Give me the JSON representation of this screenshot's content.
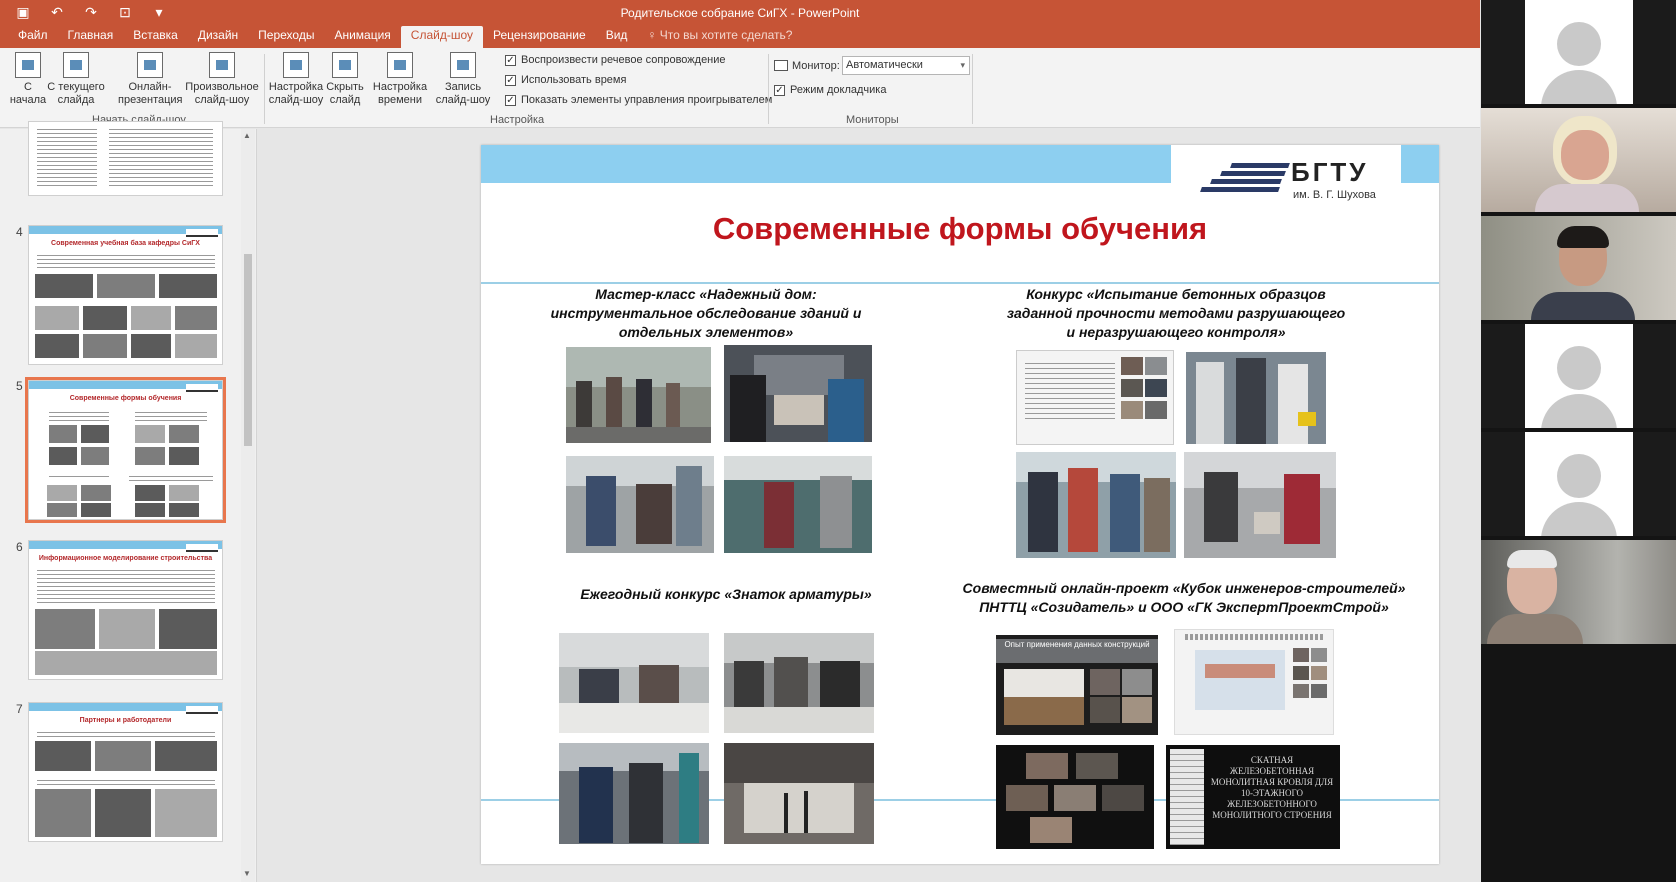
{
  "window": {
    "title": "Родительское собрание СиГХ - PowerPoint"
  },
  "tabs": [
    {
      "label": "Файл"
    },
    {
      "label": "Главная"
    },
    {
      "label": "Вставка"
    },
    {
      "label": "Дизайн"
    },
    {
      "label": "Переходы"
    },
    {
      "label": "Анимация"
    },
    {
      "label": "Слайд-шоу"
    },
    {
      "label": "Рецензирование"
    },
    {
      "label": "Вид"
    }
  ],
  "tell_me": "Что вы хотите сделать?",
  "ribbon": {
    "from_start": "С начала",
    "from_current": "С текущего слайда",
    "online": "Онлайн-презентация",
    "custom": "Произвольное слайд-шоу",
    "group_start": "Начать слайд-шоу",
    "setup": "Настройка слайд-шоу",
    "hide": "Скрыть слайд",
    "timing": "Настройка времени",
    "record": "Запись слайд-шоу",
    "chk_narration": "Воспроизвести речевое сопровождение",
    "chk_timings": "Использовать время",
    "chk_controls": "Показать элементы управления проигрывателем",
    "group_setup": "Настройка",
    "monitor_label": "Монитор:",
    "monitor_value": "Автоматически",
    "presenter_view": "Режим докладчика",
    "group_monitors": "Мониторы"
  },
  "thumbnails": [
    {
      "num": "4",
      "title": "Современная учебная база кафедры СиГХ"
    },
    {
      "num": "5",
      "title": "Современные формы обучения"
    },
    {
      "num": "6",
      "title": "Информационное моделирование строительства"
    },
    {
      "num": "7",
      "title": "Партнеры и работодатели"
    }
  ],
  "slide": {
    "logo_name": "БГТУ",
    "logo_sub": "им. В. Г. Шухова",
    "title": "Современные формы обучения",
    "cap1": "Мастер-класс «Надежный дом: инструментальное обследование зданий и отдельных элементов»",
    "cap2": "Конкурс «Испытание бетонных образцов заданной прочности методами разрушающего и неразрушающего контроля»",
    "cap3": "Ежегодный конкурс «Знаток арматуры»",
    "cap4": "Совместный онлайн-проект «Кубок инженеров-строителей» ПНТТЦ «Созидатель» и ООО «ГК ЭкспертПроектСтрой»",
    "screen1_title": "Опыт применения данных конструкций",
    "screen2_text": "СКАТНАЯ ЖЕЛЕЗОБЕТОННАЯ МОНОЛИТНАЯ КРОВЛЯ ДЛЯ 10-ЭТАЖНОГО ЖЕЛЕЗОБЕТОННОГО МОНОЛИТНОГО СТРОЕНИЯ"
  },
  "colors": {
    "accent": "#c65436",
    "slide_title": "#c0161d",
    "slide_bar": "#8dcff0"
  }
}
